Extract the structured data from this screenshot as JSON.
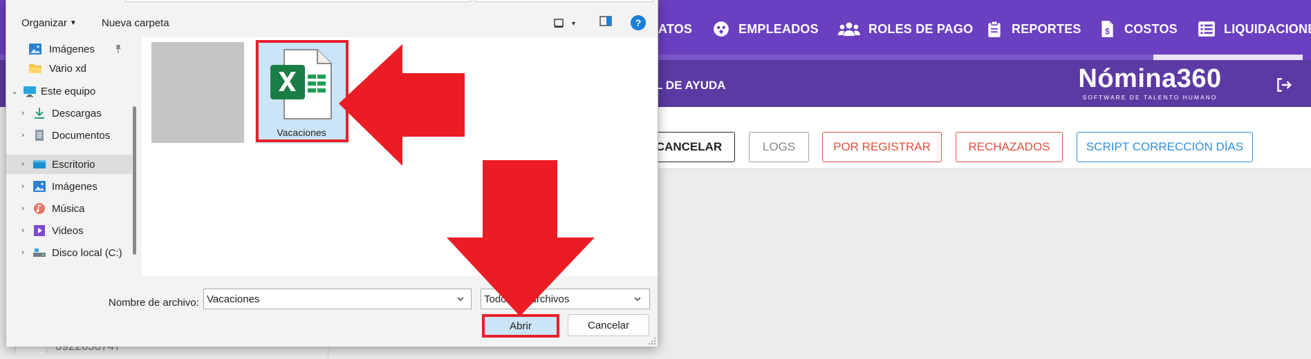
{
  "app": {
    "nav": [
      {
        "label": "ATOS",
        "icon": "contracts-icon"
      },
      {
        "label": "EMPLEADOS",
        "icon": "employees-icon"
      },
      {
        "label": "ROLES DE PAGO",
        "icon": "users-group-icon"
      },
      {
        "label": "REPORTES",
        "icon": "clipboard-icon"
      },
      {
        "label": "COSTOS",
        "icon": "cost-document-icon"
      },
      {
        "label": "LIQUIDACIONE",
        "icon": "list-icon"
      }
    ],
    "help_text": "L DE AYUDA",
    "brand": {
      "name": "Nómina360",
      "tagline": "SOFTWARE DE TALENTO HUMANO"
    },
    "toolbar": {
      "cancelar": "CANCELAR",
      "logs": "LOGS",
      "por_registrar": "POR REGISTRAR",
      "rechazados": "RECHAZADOS",
      "script": "SCRIPT CORRECCIÓN DÍAS"
    },
    "background_row_text": "0922030747",
    "colors": {
      "primary": "#6a3fc0",
      "primary_dark": "#5c3aa3",
      "danger": "#e0503a",
      "info": "#2f8fd8"
    }
  },
  "dialog": {
    "command_bar": {
      "organize": "Organizar",
      "new_folder": "Nueva carpeta"
    },
    "tree": [
      {
        "label": "Imágenes",
        "icon": "pictures-icon",
        "pinned": true
      },
      {
        "label": "Vario xd",
        "icon": "folder-icon"
      },
      {
        "label": "Este equipo",
        "icon": "computer-icon",
        "expanded": true
      },
      {
        "label": "Descargas",
        "icon": "download-icon"
      },
      {
        "label": "Documentos",
        "icon": "documents-icon"
      },
      {
        "label": "Escritorio",
        "icon": "desktop-icon",
        "selected": true
      },
      {
        "label": "Imágenes",
        "icon": "pictures-icon"
      },
      {
        "label": "Música",
        "icon": "music-icon"
      },
      {
        "label": "Videos",
        "icon": "videos-icon"
      },
      {
        "label": "Disco local (C:)",
        "icon": "drive-icon"
      }
    ],
    "files": [
      {
        "name": "Vacaciones",
        "icon": "excel-file-icon"
      }
    ],
    "filename_label": "Nombre de archivo:",
    "filename_value": "Vacaciones",
    "filetype_value": "Todos los archivos",
    "open_button": "Abrir",
    "cancel_button": "Cancelar",
    "highlight_color": "#e8202a"
  }
}
